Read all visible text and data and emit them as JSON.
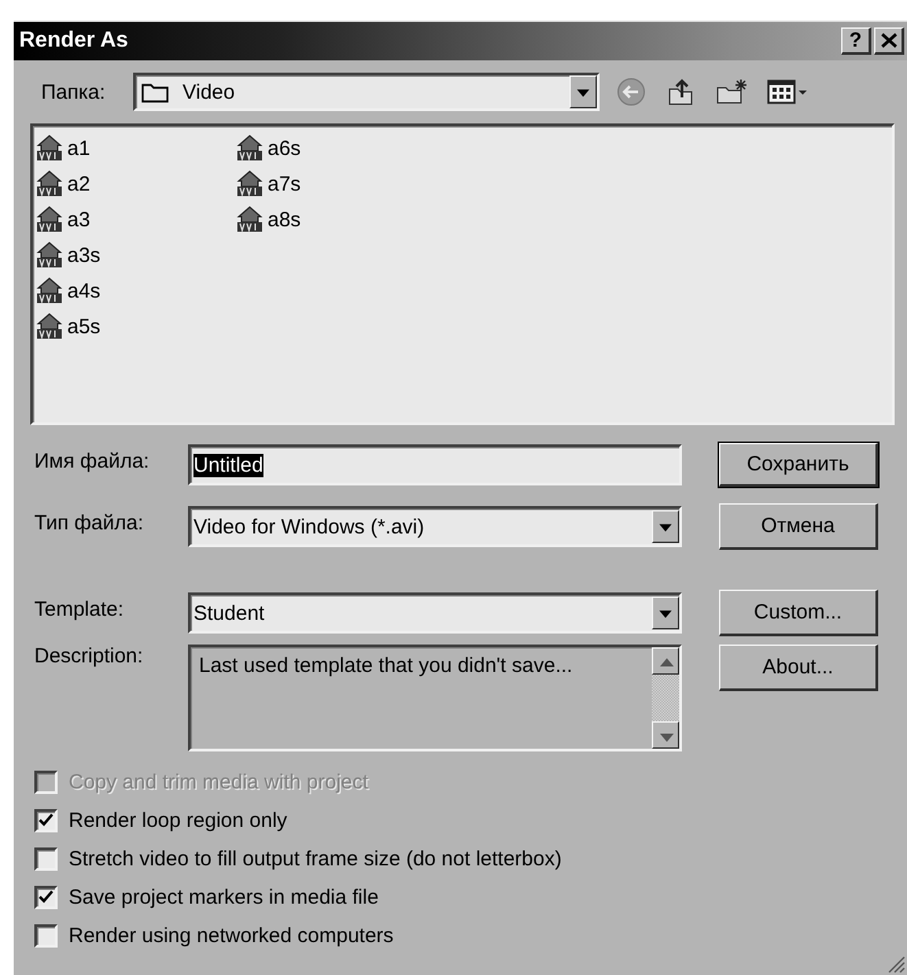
{
  "window": {
    "title": "Render As",
    "help_button": "?"
  },
  "folder": {
    "label": "Папка:",
    "value": "Video"
  },
  "files": [
    {
      "name": "a1"
    },
    {
      "name": "a2"
    },
    {
      "name": "a3"
    },
    {
      "name": "a3s"
    },
    {
      "name": "a4s"
    },
    {
      "name": "a5s"
    },
    {
      "name": "a6s"
    },
    {
      "name": "a7s"
    },
    {
      "name": "a8s"
    }
  ],
  "file_name": {
    "label": "Имя файла:",
    "value": "Untitled",
    "value_selected": true
  },
  "file_type": {
    "label": "Тип файла:",
    "value": "Video for Windows (*.avi)"
  },
  "template": {
    "label": "Template:",
    "value": "Student"
  },
  "description": {
    "label": "Description:",
    "text": "Last used template that you didn't save..."
  },
  "buttons": [
    {
      "label": "Сохранить",
      "default": true
    },
    {
      "label": "Отмена",
      "default": false
    },
    {
      "label": "Custom...",
      "default": false
    },
    {
      "label": "About...",
      "default": false
    }
  ],
  "options": [
    {
      "label": "Copy and trim media with project",
      "checked": false,
      "disabled": true
    },
    {
      "label": "Render loop region only",
      "checked": true,
      "disabled": false
    },
    {
      "label": "Stretch video to fill output frame size (do not letterbox)",
      "checked": false,
      "disabled": false
    },
    {
      "label": "Save project markers in media file",
      "checked": true,
      "disabled": false
    },
    {
      "label": "Render using networked computers",
      "checked": false,
      "disabled": false
    }
  ]
}
